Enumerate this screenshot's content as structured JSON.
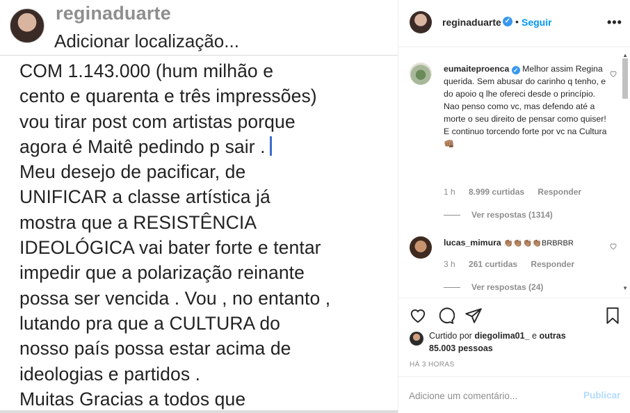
{
  "media": {
    "username": "reginaduarte",
    "location": "Adicionar localização...",
    "lines": [
      "COM  1.143.000 (hum  milhão e",
      "cento e quarenta e três impressões)",
      "vou tirar post com artistas porque",
      "agora é Maitê pedindo p sair .",
      "Meu desejo de pacificar, de",
      "UNIFICAR a classe  artística já",
      "mostra que a RESISTÊNCIA",
      "IDEOLÓGICA vai bater forte e tentar",
      "impedir que a polarização reinante",
      "possa ser vencida . Vou , no entanto ,",
      "lutando pra que a CULTURA do",
      "nosso país possa estar acima de",
      "ideologias e partidos .",
      "Muitas Gracias a todos que"
    ]
  },
  "header": {
    "username": "reginaduarte",
    "verified_mark": "✓",
    "separator": "•",
    "follow_label": "Seguir",
    "more_icon": "more-horizontal-icon",
    "more_glyph": "•••"
  },
  "comments": [
    {
      "username": "eumaiteproenca",
      "verified_mark": "✓",
      "text": "Melhor assim Regina querida. Sem abusar do carinho q tenho, e do apoio q lhe ofereci desde o princípio. Nao penso como vc, mas defendo até a morte o seu direito de pensar como quiser! E continuo torcendo forte por vc na Cultura 👊🏽",
      "time": "1 h",
      "likes": "8.999 curtidas",
      "reply_label": "Responder",
      "view_replies": "Ver respostas (1314)"
    },
    {
      "username": "lucas_mimura",
      "text": "👏🏽👏🏽👏🏽👏🏽BRBRBR",
      "time": "3 h",
      "likes": "261 curtidas",
      "reply_label": "Responder",
      "view_replies": "Ver respostas (24)"
    }
  ],
  "actions": {
    "icons": [
      "heart-icon",
      "comment-icon",
      "share-icon",
      "bookmark-icon"
    ]
  },
  "likes_summary": {
    "prefix": "Curtido por",
    "user": "diegolima01_",
    "conj": "e",
    "others": "outras 85.003 pessoas"
  },
  "timestamp": "HÁ 3 HORAS",
  "add_comment": {
    "placeholder": "Adicione um comentário...",
    "publish_label": "Publicar"
  },
  "colors": {
    "link_blue": "#0095f6",
    "publish_disabled": "#b3dbff",
    "muted": "#8e8e8e",
    "verified_blue": "#3897f0"
  }
}
